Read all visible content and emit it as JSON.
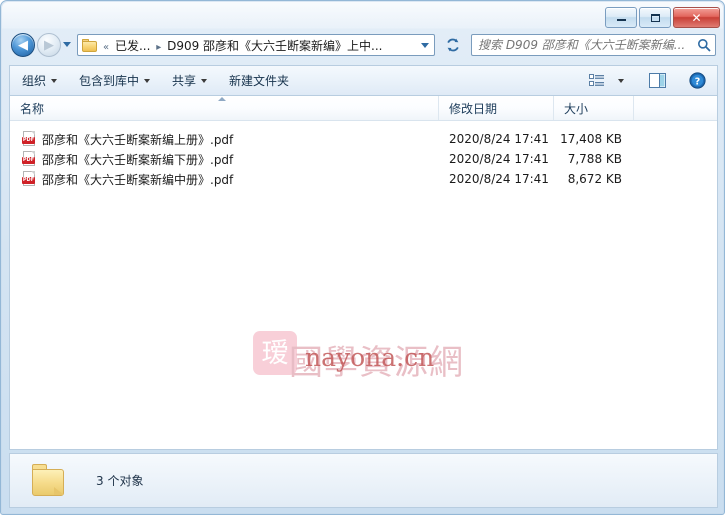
{
  "window": {
    "caption_buttons": [
      {
        "name": "minimize",
        "label": "—"
      },
      {
        "name": "maximize",
        "label": "□"
      },
      {
        "name": "close",
        "label": "✕"
      }
    ]
  },
  "navigation": {
    "back_label": "◀",
    "forward_label": "▶",
    "history_label": "▾",
    "refresh_label": "↻"
  },
  "address": {
    "overflow": "«",
    "crumb1": "已发...",
    "separator": "▸",
    "crumb2": "D909 邵彦和《大六壬断案新编》上中...",
    "dropdown_label": "▾"
  },
  "search": {
    "placeholder": "搜索 D909 邵彦和《大六壬断案新编...",
    "value": "",
    "icon": "search-icon"
  },
  "toolbar": {
    "items": [
      {
        "label": "组织",
        "has_caret": true
      },
      {
        "label": "包含到库中",
        "has_caret": true
      },
      {
        "label": "共享",
        "has_caret": true
      },
      {
        "label": "新建文件夹",
        "has_caret": false
      }
    ],
    "view_icon": "view-mode-icon",
    "view_caret": "▾",
    "preview_icon": "preview-pane-icon",
    "help_icon": "help-icon"
  },
  "listview": {
    "columns": [
      {
        "key": "name",
        "label": "名称"
      },
      {
        "key": "date",
        "label": "修改日期"
      },
      {
        "key": "size",
        "label": "大小"
      }
    ],
    "sort_column": "name",
    "sort_direction": "ascending",
    "rows": [
      {
        "icon": "pdf-file-icon",
        "badge": "PDF",
        "name": "邵彦和《大六壬断案新编上册》.pdf",
        "date": "2020/8/24 17:41",
        "size": "17,408 KB"
      },
      {
        "icon": "pdf-file-icon",
        "badge": "PDF",
        "name": "邵彦和《大六壬断案新编下册》.pdf",
        "date": "2020/8/24 17:41",
        "size": "7,788 KB"
      },
      {
        "icon": "pdf-file-icon",
        "badge": "PDF",
        "name": "邵彦和《大六壬断案新编中册》.pdf",
        "date": "2020/8/24 17:41",
        "size": "8,672 KB"
      }
    ]
  },
  "watermark": {
    "badge_glyph": "瑷",
    "chinese_text": "國學資源網",
    "latin_text": "nayona.cn"
  },
  "statusbar": {
    "folder_icon": "folder-icon",
    "text": "3 个对象"
  },
  "colors": {
    "accent": "#1c5c9e",
    "close_red": "#c83f36",
    "pdf_red": "#cf2127",
    "frame_blue": "#93b7d6",
    "watermark_pink": "#f3a9ba"
  }
}
